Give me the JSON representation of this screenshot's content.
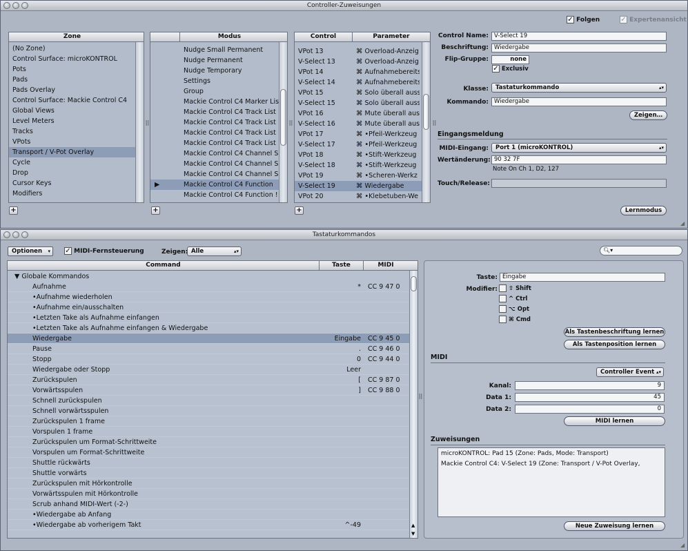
{
  "window1": {
    "title": "Controller-Zuweisungen",
    "folgen": "Folgen",
    "expertenansicht": "Expertenansicht",
    "zone": {
      "header": "Zone",
      "items": [
        "(No Zone)",
        "Control Surface: microKONTROL",
        "Pots",
        "Pads",
        "Pads Overlay",
        "Control Surface: Mackie Control C4",
        "Global Views",
        "Level Meters",
        "Tracks",
        "VPots",
        "Transport / V-Pot Overlay",
        "Cycle",
        "Drop",
        "Cursor Keys",
        "Modifiers"
      ],
      "selected": 10
    },
    "modus": {
      "header": "Modus",
      "items": [
        "Nudge Small Permanent",
        "Nudge Permanent",
        "Nudge Temporary",
        "Settings",
        "Group",
        "Mackie Control C4 Marker Lis",
        "Mackie Control C4 Track List",
        "Mackie Control C4 Track List",
        "Mackie Control C4 Track List",
        "Mackie Control C4 Track List",
        "Mackie Control C4 Channel S",
        "Mackie Control C4 Channel S",
        "Mackie Control C4 Channel S",
        "Mackie Control C4 Function",
        "Mackie Control C4 Function !"
      ],
      "selected": 13,
      "marker": "▶"
    },
    "control": {
      "header_control": "Control",
      "header_param": "Parameter",
      "rows": [
        {
          "c": "VPot 13",
          "p": "⌘ Overload-Anzeig"
        },
        {
          "c": "V-Select 13",
          "p": "⌘ Overload-Anzeig"
        },
        {
          "c": "VPot 14",
          "p": "⌘ Aufnahmebereits"
        },
        {
          "c": "V-Select 14",
          "p": "⌘ Aufnahmebereits"
        },
        {
          "c": "VPot 15",
          "p": "⌘ Solo überall auss"
        },
        {
          "c": "V-Select 15",
          "p": "⌘ Solo überall auss"
        },
        {
          "c": "VPot 16",
          "p": "⌘ Mute überall aus"
        },
        {
          "c": "V-Select 16",
          "p": "⌘ Mute überall aus"
        },
        {
          "c": "VPot 17",
          "p": "⌘ •Pfeil-Werkzeug"
        },
        {
          "c": "V-Select 17",
          "p": "⌘ •Pfeil-Werkzeug"
        },
        {
          "c": "VPot 18",
          "p": "⌘ •Stift-Werkzeug"
        },
        {
          "c": "V-Select 18",
          "p": "⌘ •Stift-Werkzeug"
        },
        {
          "c": "VPot 19",
          "p": "⌘ •Scheren-Werkz"
        },
        {
          "c": "V-Select 19",
          "p": "⌘ Wiedergabe"
        },
        {
          "c": "VPot 20",
          "p": "⌘ •Klebetuben-We"
        }
      ],
      "selected": 13
    },
    "form": {
      "control_name_label": "Control Name:",
      "control_name": "V-Select 19",
      "beschriftung_label": "Beschriftung:",
      "beschriftung": "Wiedergabe",
      "flip_label": "Flip-Gruppe:",
      "flip": "none",
      "exclusiv": "Exclusiv",
      "klasse_label": "Klasse:",
      "klasse": "Tastaturkommando",
      "kommando_label": "Kommando:",
      "kommando": "Wiedergabe",
      "zeigen": "Zeigen…",
      "eingang_section": "Eingangsmeldung",
      "midi_eingang_label": "MIDI-Eingang:",
      "midi_eingang": "Port 1 (microKONTROL)",
      "wert_label": "Wertänderung:",
      "wert": "90 32 7F",
      "note": "Note On Ch 1,  D2, 127",
      "touch_label": "Touch/Release:",
      "touch": "",
      "lernmodus": "Lernmodus"
    }
  },
  "window2": {
    "title": "Tastaturkommandos",
    "optionen": "Optionen",
    "midi_fern": "MIDI-Fernsteuerung",
    "zeigen_label": "Zeigen:",
    "zeigen_val": "Alle",
    "search_icon": "magnifier-icon",
    "table": {
      "h_command": "Command",
      "h_taste": "Taste",
      "h_midi": "MIDI",
      "group": "Globale Kommandos",
      "rows": [
        {
          "c": "Aufnahme",
          "t": "*",
          "m": "CC 9 47 0"
        },
        {
          "c": "•Aufnahme wiederholen",
          "t": "",
          "m": ""
        },
        {
          "c": "•Aufnahme ein/ausschalten",
          "t": "",
          "m": ""
        },
        {
          "c": "•Letzten Take als Aufnahme einfangen",
          "t": "",
          "m": ""
        },
        {
          "c": "•Letzten Take als Aufnahme einfangen & Wiedergabe",
          "t": "",
          "m": ""
        },
        {
          "c": "Wiedergabe",
          "t": "Eingabe",
          "m": "CC 9 45 0"
        },
        {
          "c": "Pause",
          "t": ".",
          "m": "CC 9 46 0"
        },
        {
          "c": "Stopp",
          "t": "0",
          "m": "CC 9 44 0"
        },
        {
          "c": "Wiedergabe oder Stopp",
          "t": "Leer",
          "m": ""
        },
        {
          "c": "Zurückspulen",
          "t": "[",
          "m": "CC 9 87 0"
        },
        {
          "c": "Vorwärtsspulen",
          "t": "]",
          "m": "CC 9 88 0"
        },
        {
          "c": "Schnell zurückspulen",
          "t": "",
          "m": ""
        },
        {
          "c": "Schnell vorwärtsspulen",
          "t": "",
          "m": ""
        },
        {
          "c": "Zurückspulen 1 frame",
          "t": "",
          "m": ""
        },
        {
          "c": "Vorspulen 1 frame",
          "t": "",
          "m": ""
        },
        {
          "c": "Zurückspulen um Format-Schrittweite",
          "t": "",
          "m": ""
        },
        {
          "c": "Vorspulen um Format-Schrittweite",
          "t": "",
          "m": ""
        },
        {
          "c": "Shuttle rückwärts",
          "t": "",
          "m": ""
        },
        {
          "c": "Shuttle vorwärts",
          "t": "",
          "m": ""
        },
        {
          "c": "Zurückspulen mit Hörkontrolle",
          "t": "",
          "m": ""
        },
        {
          "c": "Vorwärtsspulen mit Hörkontrolle",
          "t": "",
          "m": ""
        },
        {
          "c": "Scrub anhand MIDI-Wert (-2-)",
          "t": "",
          "m": ""
        },
        {
          "c": "•Wiedergabe ab Anfang",
          "t": "",
          "m": ""
        },
        {
          "c": "•Wiedergabe ab vorherigem Takt",
          "t": "^-49",
          "m": ""
        }
      ],
      "selected": 5
    },
    "detail": {
      "taste_label": "Taste:",
      "taste": "Eingabe",
      "modifier_label": "Modifier:",
      "modifiers": [
        {
          "sym": "⇧",
          "name": "Shift"
        },
        {
          "sym": "^",
          "name": "Ctrl"
        },
        {
          "sym": "⌥",
          "name": "Opt"
        },
        {
          "sym": "⌘",
          "name": "Cmd"
        }
      ],
      "btn_beschriftung": "Als Tastenbeschriftung lernen",
      "btn_position": "Als Tastenposition lernen",
      "midi_section": "MIDI",
      "midi_type": "Controller Event",
      "kanal_label": "Kanal:",
      "kanal": "9",
      "data1_label": "Data 1:",
      "data1": "45",
      "data2_label": "Data 2:",
      "data2": "0",
      "midi_lernen": "MIDI lernen",
      "zuw_section": "Zuweisungen",
      "zuw": [
        "microKONTROL: Pad 15 (Zone: Pads, Mode: Transport)",
        "Mackie Control C4: V-Select 19 (Zone: Transport / V-Pot Overlay,"
      ],
      "neue": "Neue Zuweisung lernen"
    }
  }
}
